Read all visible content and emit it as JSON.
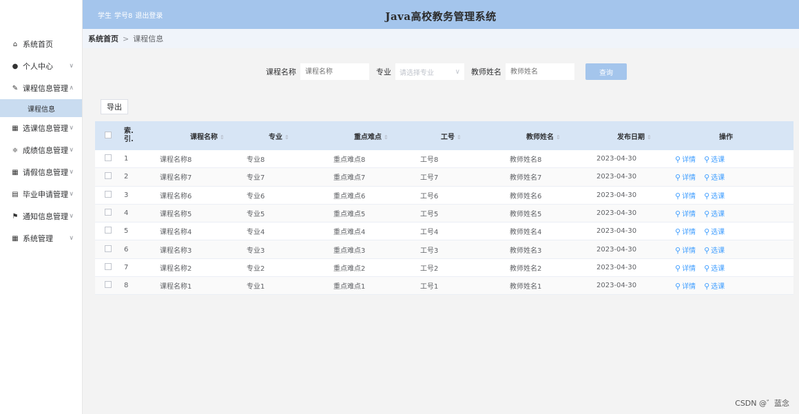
{
  "header": {
    "role": "学生",
    "user": "学号8",
    "logout": "退出登录",
    "title": "Java高校教务管理系统"
  },
  "sidebar": {
    "items": [
      {
        "label": "系统首页",
        "icon": "home-icon",
        "chevron": ""
      },
      {
        "label": "个人中心",
        "icon": "user-icon",
        "chevron": "∨"
      },
      {
        "label": "课程信息管理",
        "icon": "edit-icon",
        "chevron": "∧"
      },
      {
        "label": "选课信息管理",
        "icon": "grid-icon",
        "chevron": "∨"
      },
      {
        "label": "成绩信息管理",
        "icon": "sliders-icon",
        "chevron": "∨"
      },
      {
        "label": "请假信息管理",
        "icon": "grid-icon",
        "chevron": "∨"
      },
      {
        "label": "毕业申请管理",
        "icon": "document-icon",
        "chevron": "∨"
      },
      {
        "label": "通知信息管理",
        "icon": "flag-icon",
        "chevron": "∨"
      },
      {
        "label": "系统管理",
        "icon": "apps-icon",
        "chevron": "∨"
      }
    ],
    "sub_item": "课程信息"
  },
  "breadcrumb": {
    "home": "系统首页",
    "separator": ">",
    "current": "课程信息"
  },
  "search": {
    "course_label": "课程名称",
    "course_placeholder": "课程名称",
    "major_label": "专业",
    "major_placeholder": "请选择专业",
    "teacher_label": "教师姓名",
    "teacher_placeholder": "教师姓名",
    "query_button": "查询"
  },
  "toolbar": {
    "export_label": "导出"
  },
  "table": {
    "columns": {
      "index_line1": "索",
      "index_line2": "引",
      "name": "课程名称",
      "major": "专业",
      "key": "重点难点",
      "no": "工号",
      "teacher": "教师姓名",
      "date": "发布日期",
      "ops": "操作"
    },
    "sort_glyph": "⇕",
    "op_detail": "详情",
    "op_select": "选课",
    "rows": [
      {
        "idx": "1",
        "name": "课程名称8",
        "major": "专业8",
        "key": "重点难点8",
        "no": "工号8",
        "teacher": "教师姓名8",
        "date": "2023-04-30"
      },
      {
        "idx": "2",
        "name": "课程名称7",
        "major": "专业7",
        "key": "重点难点7",
        "no": "工号7",
        "teacher": "教师姓名7",
        "date": "2023-04-30"
      },
      {
        "idx": "3",
        "name": "课程名称6",
        "major": "专业6",
        "key": "重点难点6",
        "no": "工号6",
        "teacher": "教师姓名6",
        "date": "2023-04-30"
      },
      {
        "idx": "4",
        "name": "课程名称5",
        "major": "专业5",
        "key": "重点难点5",
        "no": "工号5",
        "teacher": "教师姓名5",
        "date": "2023-04-30"
      },
      {
        "idx": "5",
        "name": "课程名称4",
        "major": "专业4",
        "key": "重点难点4",
        "no": "工号4",
        "teacher": "教师姓名4",
        "date": "2023-04-30"
      },
      {
        "idx": "6",
        "name": "课程名称3",
        "major": "专业3",
        "key": "重点难点3",
        "no": "工号3",
        "teacher": "教师姓名3",
        "date": "2023-04-30"
      },
      {
        "idx": "7",
        "name": "课程名称2",
        "major": "专业2",
        "key": "重点难点2",
        "no": "工号2",
        "teacher": "教师姓名2",
        "date": "2023-04-30"
      },
      {
        "idx": "8",
        "name": "课程名称1",
        "major": "专业1",
        "key": "重点难点1",
        "no": "工号1",
        "teacher": "教师姓名1",
        "date": "2023-04-30"
      }
    ]
  },
  "watermark": "CSDN @゛蓝念",
  "colors": {
    "accent": "#a4c5ec",
    "link": "#409eff",
    "table_header": "#d7e5f5",
    "active_sub": "#c9dcf0"
  }
}
